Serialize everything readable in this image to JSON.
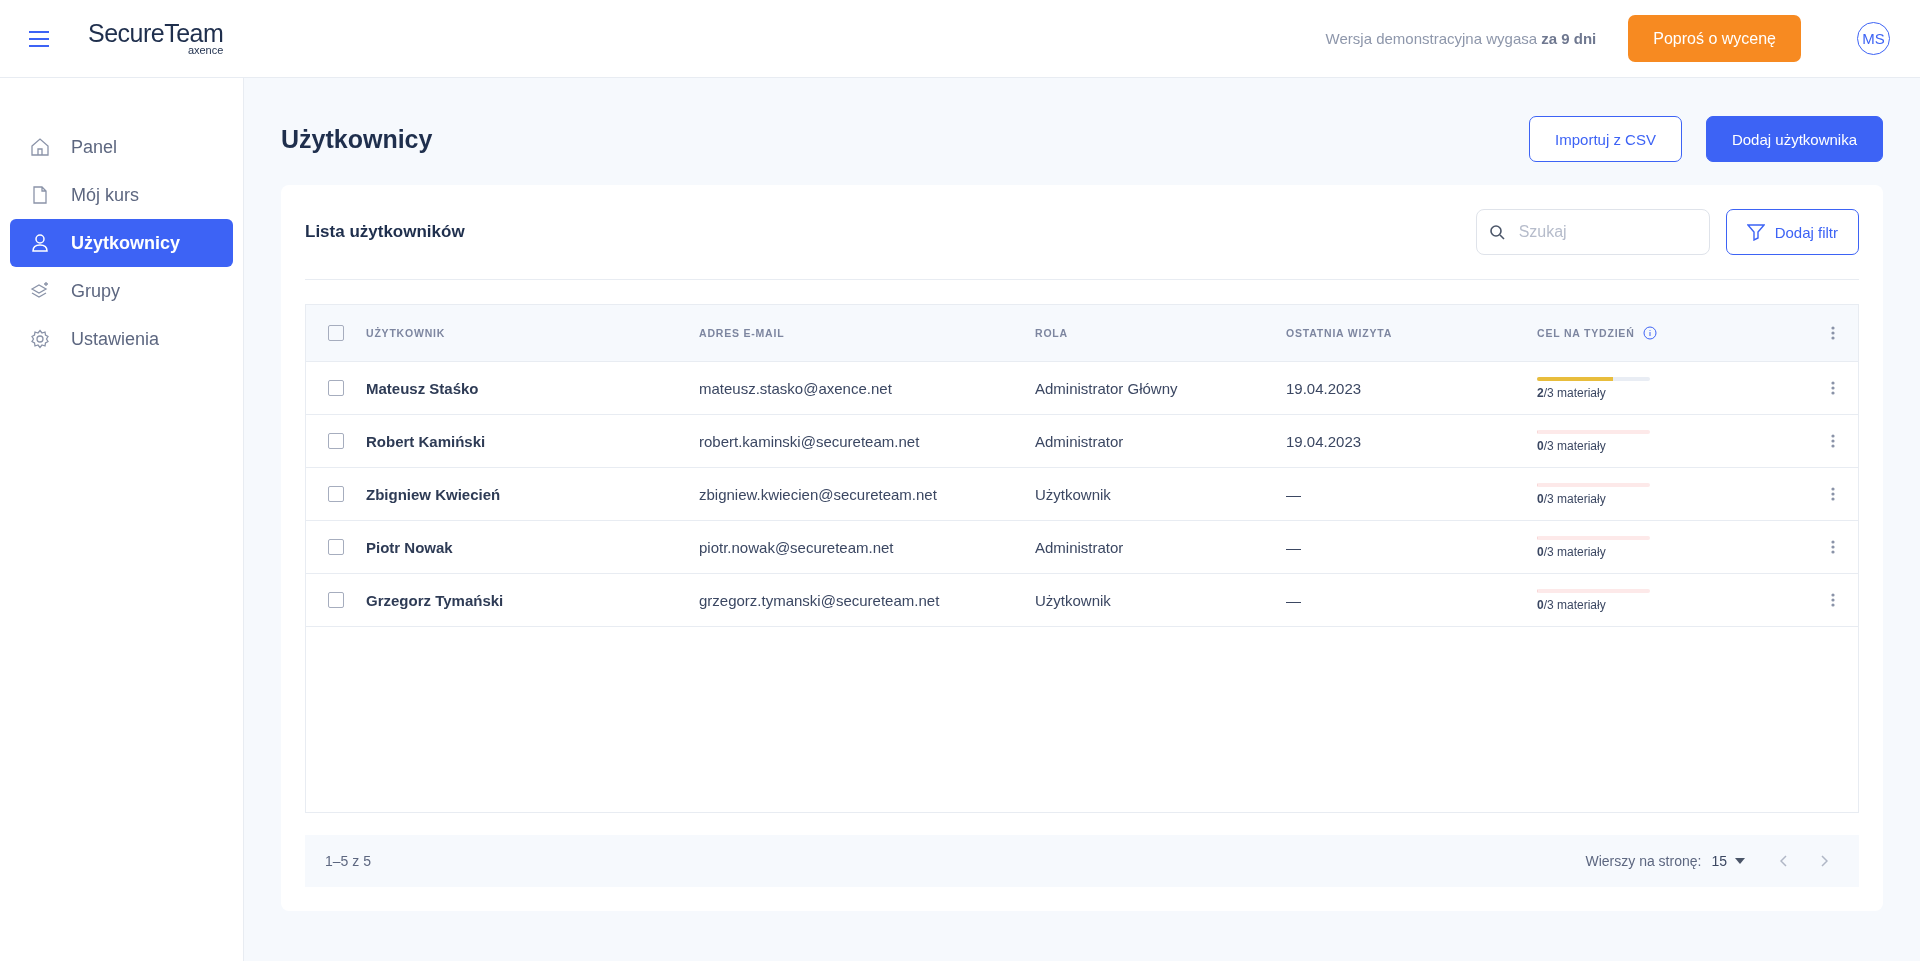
{
  "header": {
    "logo": {
      "name": "SecureTeam",
      "sub": "axence"
    },
    "trial_notice": "Wersja demonstracyjna wygasa **za 9 dni**",
    "quote_button": "Poproś o wycenę",
    "avatar": "MS"
  },
  "sidebar": {
    "items": [
      {
        "label": "Panel",
        "selected": false
      },
      {
        "label": "Mój kurs",
        "selected": false
      },
      {
        "label": "Użytkownicy",
        "selected": true
      },
      {
        "label": "Grupy",
        "selected": false
      },
      {
        "label": "Ustawienia",
        "selected": false
      }
    ]
  },
  "page": {
    "title": "Użytkownicy",
    "buttons": [
      {
        "label": "Importuj z CSV",
        "kind": "outline"
      },
      {
        "label": "Dodaj użytkownika",
        "kind": "primary"
      }
    ]
  },
  "list": {
    "title": "Lista użytkowników",
    "search": {
      "placeholder": "Szukaj"
    },
    "filter_button": "Dodaj filtr",
    "table": {
      "all_checked": false,
      "columns": [
        "UŻYTKOWNIK",
        "ADRES E-MAIL",
        "ROLA",
        "OSTATNIA WIZYTA",
        "CEL NA TYDZIEŃ"
      ],
      "rows": [
        {
          "checked": false,
          "name": "Mateusz Staśko",
          "email": "mateusz.stasko@axence.net",
          "role": "Administrator Główny",
          "last_visit": "19.04.2023",
          "goal": "**2**/3 materiały",
          "level": 0.67
        },
        {
          "checked": false,
          "name": "Robert Kamiński",
          "email": "robert.kaminski@secureteam.net",
          "role": "Administrator",
          "last_visit": "19.04.2023",
          "goal": "**0**/3 materiały",
          "level": 0
        },
        {
          "checked": false,
          "name": "Zbigniew Kwiecień",
          "email": "zbigniew.kwiecien@secureteam.net",
          "role": "Użytkownik",
          "last_visit": "—",
          "goal": "**0**/3 materiały",
          "level": 0
        },
        {
          "checked": false,
          "name": "Piotr Nowak",
          "email": "piotr.nowak@secureteam.net",
          "role": "Administrator",
          "last_visit": "—",
          "goal": "**0**/3 materiały",
          "level": 0
        },
        {
          "checked": false,
          "name": "Grzegorz Tymański",
          "email": "grzegorz.tymanski@secureteam.net",
          "role": "Użytkownik",
          "last_visit": "—",
          "goal": "**0**/3 materiały",
          "level": 0
        }
      ]
    },
    "pagination": {
      "range": "1–5 z 5",
      "rows_per_page_label": "Wierszy na stronę:",
      "rows_per_page": "15"
    }
  }
}
